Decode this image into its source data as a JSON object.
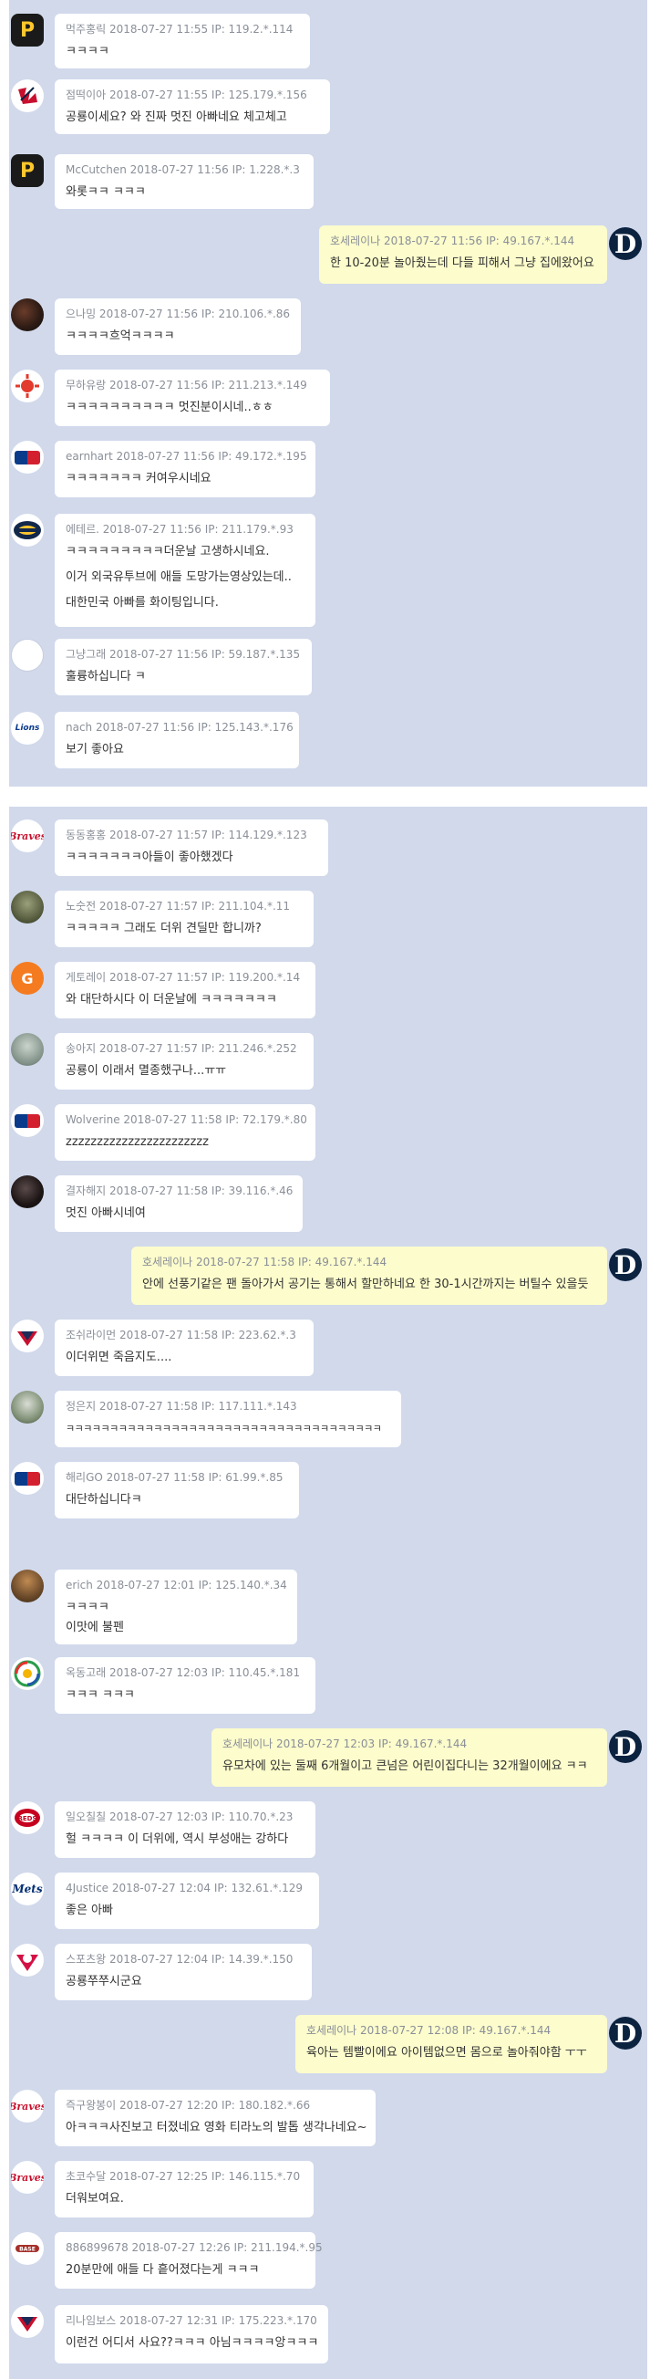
{
  "colors": {
    "panel": "#d1d9eb",
    "bubble_other": "#ffffff",
    "bubble_self": "#fcfccc",
    "meta_text": "#8a8f98",
    "body_text": "#333333"
  },
  "icons": {
    "pirates": "pirates-p-icon",
    "tigers": "tigers-d-icon",
    "redsox": "red-sox-icon",
    "mlb": "mlb-logo-icon",
    "brewers": "brewers-icon",
    "lions": "lions-icon",
    "braves": "braves-icon",
    "gatorade": "gatorade-icon",
    "ssg": "korean-team-icon",
    "wbc": "wbc-icon",
    "reds": "reds-icon",
    "mets": "mets-icon",
    "twins": "twins-icon",
    "photo": "profile-photo-avatar"
  },
  "avatar_glyphs": {
    "pirates": "P",
    "tigers": "D",
    "lions": "Lions",
    "braves": "Braves",
    "gatorade": "G",
    "mets": "Mets"
  },
  "messages": [
    {
      "meta": "먹주홍릭 2018-07-27 11:55 IP: 119.2.*.114",
      "lines": [
        "ㅋㅋㅋㅋ"
      ]
    },
    {
      "meta": "점떡이아 2018-07-27 11:55 IP: 125.179.*.156",
      "lines": [
        "공룡이세요? 와 진짜 멋진 아빠네요 체고체고"
      ]
    },
    {
      "meta": "McCutchen 2018-07-27 11:56 IP: 1.228.*.3",
      "lines": [
        "와롯ㅋㅋ ㅋㅋㅋ"
      ]
    },
    {
      "meta": "호세레이나 2018-07-27 11:56 IP: 49.167.*.144",
      "lines": [
        "한 10-20분 놀아줬는데 다들 피해서 그냥 집에왔어요"
      ]
    },
    {
      "meta": "으나밍 2018-07-27 11:56 IP: 210.106.*.86",
      "lines": [
        "ㅋㅋㅋㅋ흐억ㅋㅋㅋㅋ"
      ]
    },
    {
      "meta": "무하유랑 2018-07-27 11:56 IP: 211.213.*.149",
      "lines": [
        "ㅋㅋㅋㅋㅋㅋㅋㅋㅋㅋ 멋진분이시네..ㅎㅎ"
      ]
    },
    {
      "meta": "earnhart 2018-07-27 11:56 IP: 49.172.*.195",
      "lines": [
        "ㅋㅋㅋㅋㅋㅋㅋ 커여우시네요"
      ]
    },
    {
      "meta": "에테르. 2018-07-27 11:56 IP: 211.179.*.93",
      "lines": [
        "ㅋㅋㅋㅋㅋㅋㅋㅋㅋ더운날 고생하시네요.",
        "이거 외국유투브에 애들 도망가는영상있는데..",
        "대한민국 아빠를 화이팅입니다."
      ]
    },
    {
      "meta": "그냥그래 2018-07-27 11:56 IP: 59.187.*.135",
      "lines": [
        "훌륭하십니다 ㅋ"
      ]
    },
    {
      "meta": "nach 2018-07-27 11:56 IP: 125.143.*.176",
      "lines": [
        "보기 좋아요"
      ]
    },
    {
      "meta": "동동홍홍 2018-07-27 11:57 IP: 114.129.*.123",
      "lines": [
        "ㅋㅋㅋㅋㅋㅋㅋ아들이 좋아했겠다"
      ]
    },
    {
      "meta": "노숫전 2018-07-27 11:57 IP: 211.104.*.11",
      "lines": [
        "ㅋㅋㅋㅋㅋ 그래도 더위 견딜만 합니까?"
      ]
    },
    {
      "meta": "게토레이 2018-07-27 11:57 IP: 119.200.*.14",
      "lines": [
        "와 대단하시다 이 더운날에 ㅋㅋㅋㅋㅋㅋㅋ"
      ]
    },
    {
      "meta": "송아지 2018-07-27 11:57 IP: 211.246.*.252",
      "lines": [
        "공룡이 이래서 멸종했구나...ㅠㅠ"
      ]
    },
    {
      "meta": "Wolverine 2018-07-27 11:58 IP: 72.179.*.80",
      "lines": [
        "zzzzzzzzzzzzzzzzzzzzzzz"
      ]
    },
    {
      "meta": "결자해지 2018-07-27 11:58 IP: 39.116.*.46",
      "lines": [
        "멋진 아빠시네여"
      ]
    },
    {
      "meta": "호세레이나 2018-07-27 11:58 IP: 49.167.*.144",
      "lines": [
        "안에 선풍기같은 팬 돌아가서 공기는 통해서 할만하네요 한 30-1시간까지는 버틸수 있을듯"
      ]
    },
    {
      "meta": "조쉬라이먼 2018-07-27 11:58 IP: 223.62.*.3",
      "lines": [
        "이더위면 죽음지도...."
      ]
    },
    {
      "meta": "정은지 2018-07-27 11:58 IP: 117.111.*.143",
      "lines": [
        "ㅋㅋㅋㅋㅋㅋㅋㅋㅋㅋㅋㅋㅋㅋㅋㅋㅋㅋㅋㅋㅋㅋㅋㅋㅋㅋㅋㅋㅋㅋㅋㅋㅋㅋㅋㅋ"
      ]
    },
    {
      "meta": "해리GO 2018-07-27 11:58 IP: 61.99.*.85",
      "lines": [
        "대단하십니다ㅋ"
      ]
    },
    {
      "meta": "erich 2018-07-27 12:01 IP: 125.140.*.34",
      "lines": [
        "ㅋㅋㅋㅋ",
        "이맛에 불펜"
      ]
    },
    {
      "meta": "옥동고래 2018-07-27 12:03 IP: 110.45.*.181",
      "lines": [
        "ㅋㅋㅋ ㅋㅋㅋ"
      ]
    },
    {
      "meta": "호세레이나 2018-07-27 12:03 IP: 49.167.*.144",
      "lines": [
        "유모차에 있는 둘째 6개월이고 큰넘은 어린이집다니는 32개월이에요 ㅋㅋ"
      ]
    },
    {
      "meta": "일오칠칠 2018-07-27 12:03 IP: 110.70.*.23",
      "lines": [
        "헐 ㅋㅋㅋㅋ 이 더위에, 역시 부성애는 강하다"
      ]
    },
    {
      "meta": "4Justice 2018-07-27 12:04 IP: 132.61.*.129",
      "lines": [
        "좋은 아빠"
      ]
    },
    {
      "meta": "스포츠왕 2018-07-27 12:04 IP: 14.39.*.150",
      "lines": [
        "공룡쭈쭈시군요"
      ]
    },
    {
      "meta": "호세레이나 2018-07-27 12:08 IP: 49.167.*.144",
      "lines": [
        "육아는 템빨이에요 아이템없으면 몸으로 놀아줘야함 ㅜㅜ"
      ]
    },
    {
      "meta": "즉구왕봉이 2018-07-27 12:20 IP: 180.182.*.66",
      "lines": [
        "아ㅋㅋㅋ사진보고 터졌네요 영화 티라노의 발톱 생각나네요~"
      ]
    },
    {
      "meta": "초코수달 2018-07-27 12:25 IP: 146.115.*.70",
      "lines": [
        "더워보여요."
      ]
    },
    {
      "meta": "886899678 2018-07-27 12:26 IP: 211.194.*.95",
      "lines": [
        "20분만에 애들 다 흩어졌다는게 ㅋㅋㅋ"
      ]
    },
    {
      "meta": "리나임보스 2018-07-27 12:31 IP: 175.223.*.170",
      "lines": [
        "이런건 어디서 사요??ㅋㅋㅋ 아님ㅋㅋㅋㅋ앙ㅋㅋㅋ"
      ]
    }
  ]
}
